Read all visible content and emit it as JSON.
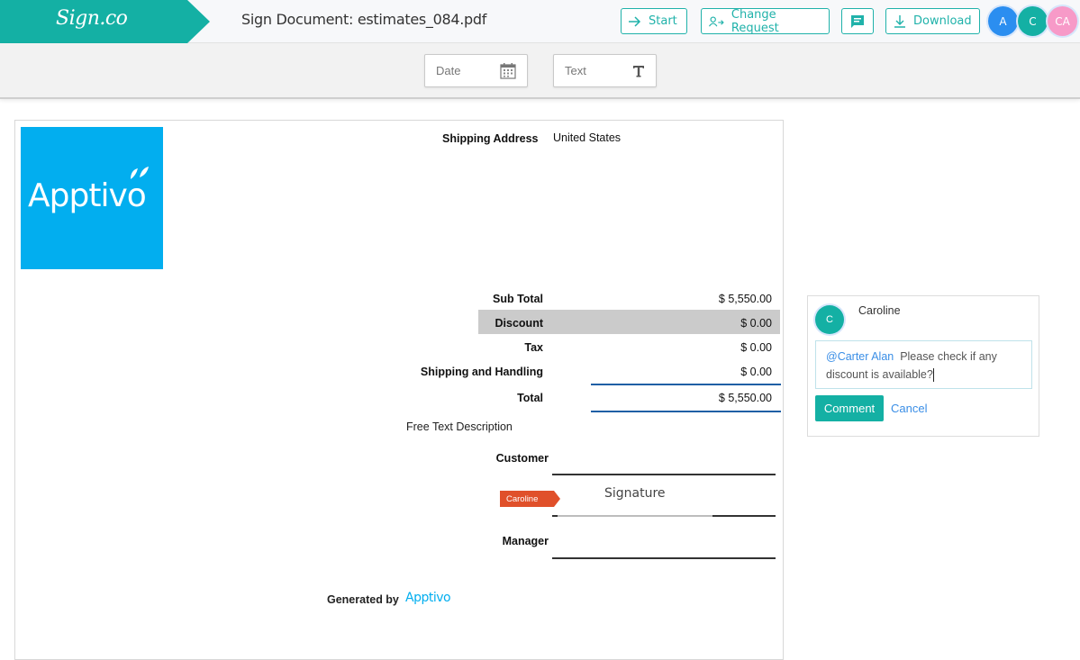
{
  "header": {
    "brand": "Sign.co",
    "title": "Sign Document: estimates_084.pdf",
    "buttons": {
      "start": "Start",
      "change_request": "Change Request",
      "download": "Download"
    },
    "avatars": [
      {
        "initials": "A",
        "color": "#2b8ef0"
      },
      {
        "initials": "C",
        "color": "#14b0a4"
      },
      {
        "initials": "CA",
        "color": "#f79ac8"
      }
    ]
  },
  "fields_toolbar": {
    "date_label": "Date",
    "text_label": "Text"
  },
  "document": {
    "logo_text": "Apptivo",
    "shipping_address_label": "Shipping Address",
    "shipping_address_value": "United States",
    "totals": [
      {
        "label": "Sub Total",
        "value": "$ 5,550.00"
      },
      {
        "label": "Discount",
        "value": "$ 0.00"
      },
      {
        "label": "Tax",
        "value": "$ 0.00"
      },
      {
        "label": "Shipping and Handling",
        "value": "$ 0.00"
      },
      {
        "label": "Total",
        "value": "$ 5,550.00"
      }
    ],
    "free_text": "Free Text Description",
    "customer_label": "Customer",
    "signer_tag": "Caroline",
    "signature_field": "Signature",
    "manager_label": "Manager",
    "generated_by": "Generated by",
    "generated_logo": "Apptivo"
  },
  "comment": {
    "author_initial": "C",
    "author": "Caroline",
    "mention": "@Carter Alan",
    "text": "Please check if any discount is available?",
    "submit": "Comment",
    "cancel": "Cancel"
  },
  "colors": {
    "brand": "#14b0a4",
    "signer_tag": "#e0502a",
    "total_line": "#1f5fa5",
    "logo_bg": "#02aeef"
  }
}
